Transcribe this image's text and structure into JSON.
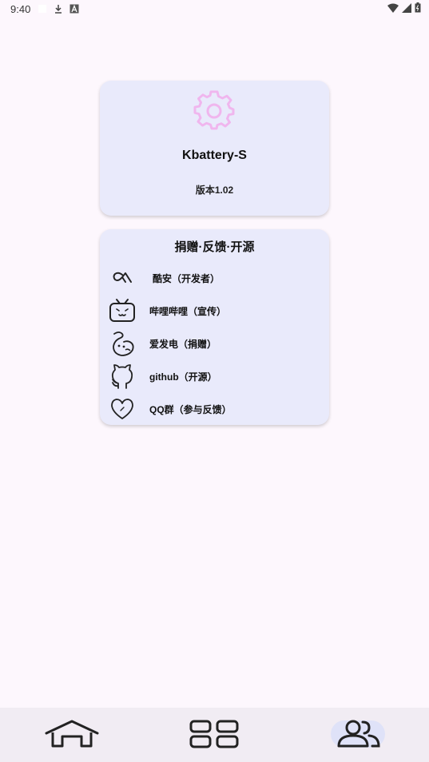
{
  "status_bar": {
    "time": "9:40",
    "icons_left": [
      "notification-icon",
      "download-icon",
      "a-icon"
    ],
    "icons_right": [
      "wifi-icon",
      "signal-icon",
      "battery-icon"
    ]
  },
  "about": {
    "icon": "gear-icon",
    "app_name": "Kbattery-S",
    "version": "版本1.02",
    "accent_color": "#f0b6ee"
  },
  "links": {
    "title": "捐赠·反馈·开源",
    "items": [
      {
        "icon": "coolapk-icon",
        "label": "酷安（开发者）"
      },
      {
        "icon": "bilibili-icon",
        "label": "哔哩哔哩（宣传）"
      },
      {
        "icon": "afdian-icon",
        "label": "爱发电（捐赠）"
      },
      {
        "icon": "github-icon",
        "label": "github（开源）"
      },
      {
        "icon": "heart-icon",
        "label": "QQ群（参与反馈）"
      }
    ]
  },
  "bottom_nav": {
    "items": [
      {
        "icon": "home-icon",
        "active": false
      },
      {
        "icon": "grid-icon",
        "active": false
      },
      {
        "icon": "people-icon",
        "active": true
      }
    ],
    "active_color": "#dfe2f8"
  }
}
